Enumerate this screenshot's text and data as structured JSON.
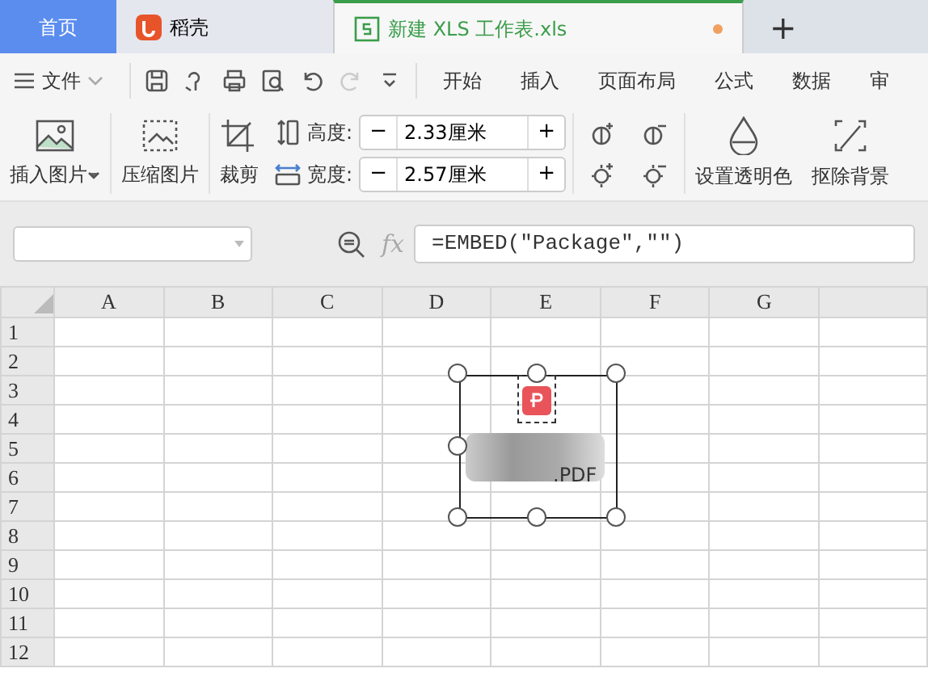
{
  "tabs": [
    {
      "label": "首页",
      "kind": "home",
      "selected": false
    },
    {
      "label": "稻壳",
      "kind": "docer",
      "selected": false
    },
    {
      "label": "新建 XLS 工作表.xls",
      "kind": "sheet",
      "selected": true,
      "unsaved": true
    }
  ],
  "new_tab": "+",
  "menu": {
    "file_label": "文件",
    "items": [
      {
        "label": "开始",
        "selected": false
      },
      {
        "label": "插入",
        "selected": false
      },
      {
        "label": "页面布局",
        "selected": false
      },
      {
        "label": "公式",
        "selected": false
      },
      {
        "label": "数据",
        "selected": false
      },
      {
        "label": "审",
        "selected": false
      }
    ]
  },
  "ribbon": {
    "insert_picture": "插入图片",
    "compress_picture": "压缩图片",
    "crop": "裁剪",
    "height_label": "高度:",
    "height_value": "2.33厘米",
    "width_label": "宽度:",
    "width_value": "2.57厘米",
    "minus": "−",
    "plus": "+",
    "set_transparent": "设置透明色",
    "remove_background": "抠除背景"
  },
  "formula_bar": {
    "fx_label": "fx",
    "formula": "=EMBED(\"Package\",\"\")"
  },
  "sheet": {
    "columns": [
      "A",
      "B",
      "C",
      "D",
      "E",
      "F",
      "G"
    ],
    "rows": [
      "1",
      "2",
      "3",
      "4",
      "5",
      "6",
      "7",
      "8",
      "9",
      "10",
      "11",
      "12"
    ],
    "embedded_object": {
      "file_suffix": ".PDF",
      "selected": true
    }
  }
}
